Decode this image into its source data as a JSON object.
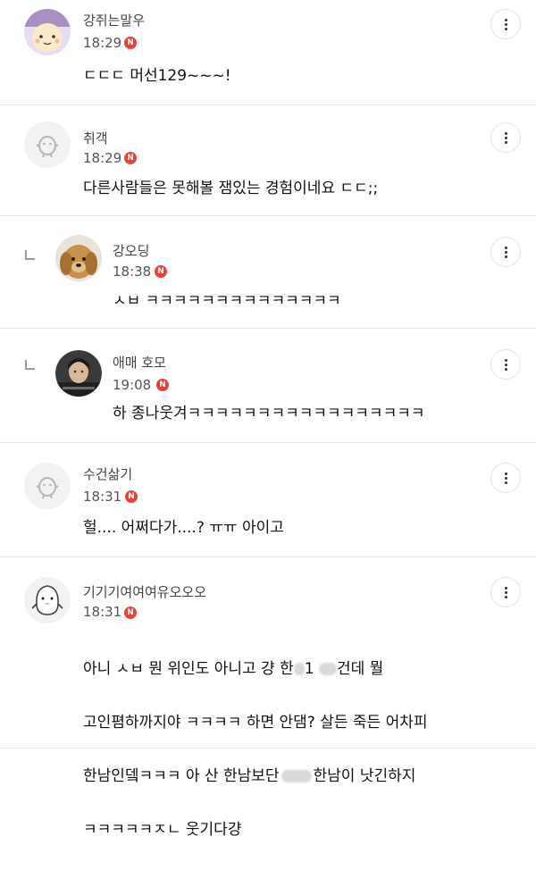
{
  "comments": [
    {
      "name": "강쥐는말우",
      "time": "18:29",
      "badge": "N",
      "text": "ㄷㄷㄷ 머선129~~~!"
    },
    {
      "name": "취객",
      "time": "18:29",
      "badge": "N",
      "text": "다른사람들은 못해볼 잼있는 경험이네요 ㄷㄷ;;"
    },
    {
      "name": "강오딩",
      "time": "18:38",
      "badge": "N",
      "text": "ㅅㅂ ㅋㅋㅋㅋㅋㅋㅋㅋㅋㅋㅋㅋㅋㅋ"
    },
    {
      "name": "애매 호모",
      "time": "19:08",
      "badge": "N",
      "text": "하 종나웃겨ㅋㅋㅋㅋㅋㅋㅋㅋㅋㅋㅋㅋㅋㅋㅋㅋㅋ"
    },
    {
      "name": "수건삶기",
      "time": "18:31",
      "badge": "N",
      "text": "헐.... 어쩌다가....? ㅠㅠ 아이고"
    },
    {
      "name": "기기기여여여유오오오",
      "time": "18:31",
      "badge": "N",
      "text_line1a": "아니 ㅅㅂ 뭔 위인도 아니고 걍 한",
      "text_line1b": "1",
      "text_line1c": "건데 뭘",
      "text_line2": "고인폄하까지야 ㅋㅋㅋㅋ 하면 안댐? 살든 죽든 어차피",
      "text_line3a": "한남인뎈ㅋㅋㅋ 아 산 한남보단",
      "text_line3b": "한남이 낫긴하지",
      "text_line4": "ㅋㅋㅋㅋㅋㅈㄴ 웃기다걍"
    }
  ]
}
